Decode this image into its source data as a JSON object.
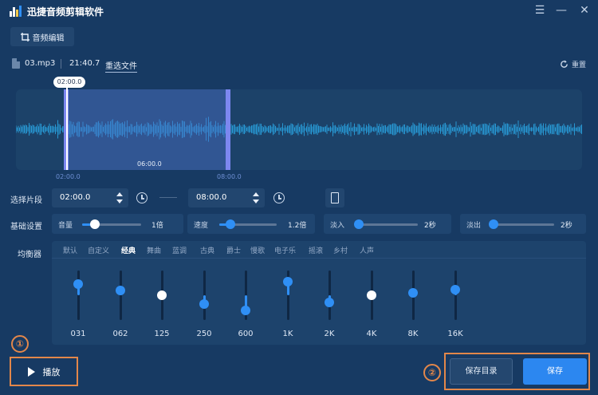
{
  "app": {
    "title": "迅捷音频剪辑软件"
  },
  "window": {
    "menu_glyph": "☰",
    "minimize_glyph": "—",
    "close_glyph": "✕"
  },
  "tab": {
    "label": "音频编辑"
  },
  "file": {
    "name": "03.mp3",
    "duration": "21:40.7",
    "reselect_label": "重选文件"
  },
  "reset": {
    "label": "重置"
  },
  "waveform": {
    "playhead_time": "02:00.0",
    "selection_duration": "06:00.0",
    "start_label": "02:00.0",
    "end_label": "08:00.0",
    "colors": {
      "background": "#1c4269",
      "wave": "#2aa8e6",
      "selection": "#4b6ec8",
      "handle": "#7d87f0"
    }
  },
  "segment": {
    "label": "选择片段",
    "start": "02:00.0",
    "end": "08:00.0"
  },
  "basic": {
    "label": "基础设置",
    "volume": {
      "label": "音量",
      "value": "1倍",
      "level": 0.22
    },
    "speed": {
      "label": "速度",
      "value": "1.2倍",
      "level": 0.2
    },
    "fade_in": {
      "label": "淡入",
      "value": "2秒",
      "level": 0.05
    },
    "fade_out": {
      "label": "淡出",
      "value": "2秒",
      "level": 0.05
    }
  },
  "equalizer": {
    "label": "均衡器",
    "presets": [
      "默认",
      "自定义",
      "经典",
      "舞曲",
      "蓝调",
      "古典",
      "爵士",
      "慢歌",
      "电子乐",
      "摇滚",
      "乡村",
      "人声"
    ],
    "active_preset": "经典",
    "bands": [
      {
        "freq": "031",
        "level": 0.72,
        "active": true
      },
      {
        "freq": "062",
        "level": 0.6,
        "active": true
      },
      {
        "freq": "125",
        "level": 0.5,
        "active": false
      },
      {
        "freq": "250",
        "level": 0.33,
        "active": true
      },
      {
        "freq": "600",
        "level": 0.2,
        "active": true
      },
      {
        "freq": "1K",
        "level": 0.78,
        "active": true
      },
      {
        "freq": "2K",
        "level": 0.35,
        "active": true
      },
      {
        "freq": "4K",
        "level": 0.5,
        "active": false
      },
      {
        "freq": "8K",
        "level": 0.55,
        "active": true
      },
      {
        "freq": "16K",
        "level": 0.62,
        "active": true
      }
    ]
  },
  "controls": {
    "play_label": "播放",
    "save_dir_label": "保存目录",
    "save_label": "保存"
  },
  "annotations": {
    "marker_1": "①",
    "marker_2": "②"
  },
  "colors": {
    "accent": "#2c87f0",
    "highlight": "#e3874a",
    "background": "#173a63"
  }
}
